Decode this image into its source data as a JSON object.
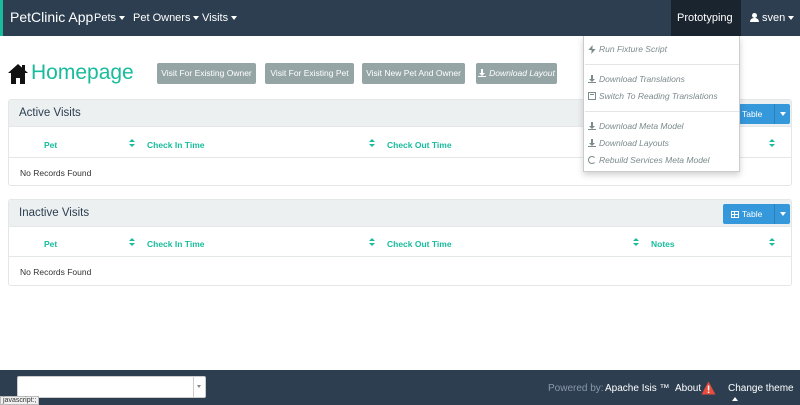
{
  "navbar": {
    "brand": "PetClinic App",
    "menus": [
      {
        "label": "Pets"
      },
      {
        "label": "Pet Owners"
      },
      {
        "label": "Visits"
      }
    ],
    "prototyping": "Prototyping",
    "user": "sven"
  },
  "prototyping_menu": {
    "items": [
      {
        "label": "Run Fixture Script",
        "icon": "bolt-icon"
      },
      {
        "label": "Download Translations",
        "icon": "download-icon"
      },
      {
        "label": "Switch To Reading Translations",
        "icon": "book-icon"
      },
      {
        "label": "Download Meta Model",
        "icon": "download-icon"
      },
      {
        "label": "Download Layouts",
        "icon": "download-icon"
      },
      {
        "label": "Rebuild Services Meta Model",
        "icon": "refresh-icon"
      }
    ]
  },
  "page": {
    "title": "Homepage",
    "actions": [
      {
        "label": "Visit For Existing Owner"
      },
      {
        "label": "Visit For Existing Pet"
      },
      {
        "label": "Visit New Pet And Owner"
      },
      {
        "label": "Download Layout"
      }
    ]
  },
  "active_visits": {
    "title": "Active Visits",
    "view_button": "Table",
    "columns": [
      "Pet",
      "Check In Time",
      "Check Out Time"
    ],
    "empty_text": "No Records Found"
  },
  "inactive_visits": {
    "title": "Inactive Visits",
    "view_button": "Table",
    "columns": [
      "Pet",
      "Check In Time",
      "Check Out Time",
      "Notes"
    ],
    "empty_text": "No Records Found"
  },
  "footer": {
    "theme_select_value": "",
    "powered_by": "Powered by:",
    "framework": "Apache Isis ™",
    "about": "About",
    "change_theme": "Change theme"
  },
  "status_bar": "javascript:;",
  "colors": {
    "navbar": "#2c3e50",
    "accent": "#18bc9c",
    "primary": "#3498db",
    "default_button": "#95a5a6",
    "warning": "#e74c3c"
  }
}
